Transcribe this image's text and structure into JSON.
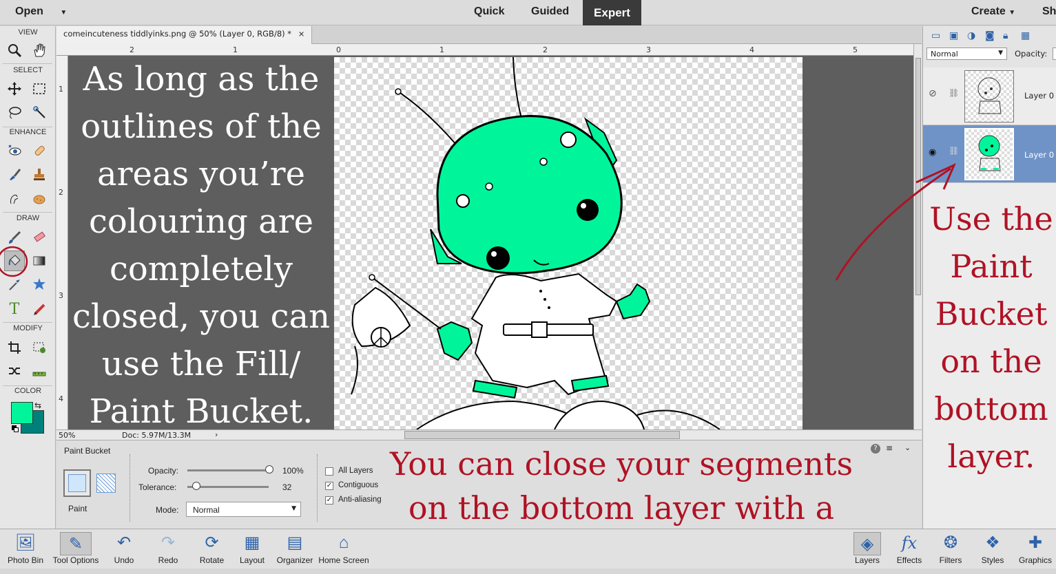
{
  "topbar": {
    "open": "Open",
    "modes": [
      "Quick",
      "Guided",
      "Expert"
    ],
    "create": "Create",
    "share": "Sh"
  },
  "toolbox": {
    "sections": [
      "VIEW",
      "SELECT",
      "ENHANCE",
      "DRAW",
      "MODIFY",
      "COLOR"
    ],
    "foreground_color": "#00f59b",
    "background_color": "#00807a"
  },
  "document": {
    "tab_title": "comeincuteness tiddlyinks.png @ 50% (Layer 0, RGB/8) *",
    "close": "×",
    "ruler_top": [
      "2",
      "1",
      "0",
      "1",
      "2",
      "3",
      "4",
      "5"
    ],
    "ruler_left": [
      "1",
      "2",
      "3",
      "4"
    ],
    "zoom": "50%",
    "doc_size": "Doc: 5.97M/13.3M",
    "overlay_text": "As long as the outlines of the areas you’re colouring are completely closed, you can use the Fill/ Paint Bucket."
  },
  "tool_options": {
    "tool_name": "Paint Bucket",
    "paint_label": "Paint",
    "opacity_label": "Opacity:",
    "opacity_value": "100%",
    "opacity_fraction": 1.0,
    "tolerance_label": "Tolerance:",
    "tolerance_value": "32",
    "tolerance_fraction": 0.12,
    "mode_label": "Mode:",
    "mode_value": "Normal",
    "all_layers": "All Layers",
    "contiguous": "Contiguous",
    "anti_aliasing": "Anti-aliasing",
    "overlay_text": "You can close your segments on the bottom layer with a small black brush."
  },
  "layers_panel": {
    "blend_mode": "Normal",
    "opacity_label": "Opacity:",
    "layers": [
      {
        "name": "Layer 0",
        "visible": false
      },
      {
        "name": "Layer 0",
        "visible": true,
        "selected": true
      }
    ],
    "overlay_text": "Use the Paint Bucket on the bottom layer."
  },
  "bottombar": {
    "left": [
      "Photo Bin",
      "Tool Options",
      "Undo",
      "Redo",
      "Rotate",
      "Layout",
      "Organizer",
      "Home Screen"
    ],
    "right": [
      "Layers",
      "Effects",
      "Filters",
      "Styles",
      "Graphics"
    ]
  },
  "colors": {
    "accent_red": "#b01224",
    "alien_green": "#00f59b",
    "selected_layer": "#6f93c7"
  }
}
